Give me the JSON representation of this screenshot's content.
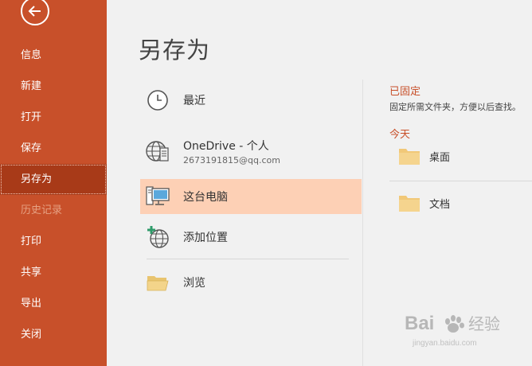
{
  "sidebar": {
    "items": [
      {
        "label": "信息"
      },
      {
        "label": "新建"
      },
      {
        "label": "打开"
      },
      {
        "label": "保存"
      },
      {
        "label": "另存为"
      },
      {
        "label": "历史记录"
      },
      {
        "label": "打印"
      },
      {
        "label": "共享"
      },
      {
        "label": "导出"
      },
      {
        "label": "关闭"
      }
    ]
  },
  "main": {
    "title": "另存为",
    "locations": [
      {
        "label": "最近",
        "icon": "clock-icon"
      },
      {
        "label": "OneDrive - 个人",
        "sub": "2673191815@qq.com",
        "icon": "onedrive-globe-icon"
      },
      {
        "label": "这台电脑",
        "icon": "computer-icon"
      },
      {
        "label": "添加位置",
        "icon": "add-location-icon"
      },
      {
        "label": "浏览",
        "icon": "folder-open-icon"
      }
    ]
  },
  "right": {
    "pinned_title": "已固定",
    "pinned_desc": "固定所需文件夹，方便以后查找。",
    "today_title": "今天",
    "folders": [
      {
        "label": "桌面",
        "icon": "folder-icon"
      },
      {
        "label": "文档",
        "icon": "folder-icon"
      }
    ]
  },
  "watermark": {
    "brand": "Bai",
    "brand2": "经验",
    "url": "jingyan.baidu.com"
  },
  "colors": {
    "sidebar": "#c8502a",
    "selected_sidebar": "#a83a18",
    "selected_location": "#fdd0b5",
    "accent": "#c8502a"
  }
}
